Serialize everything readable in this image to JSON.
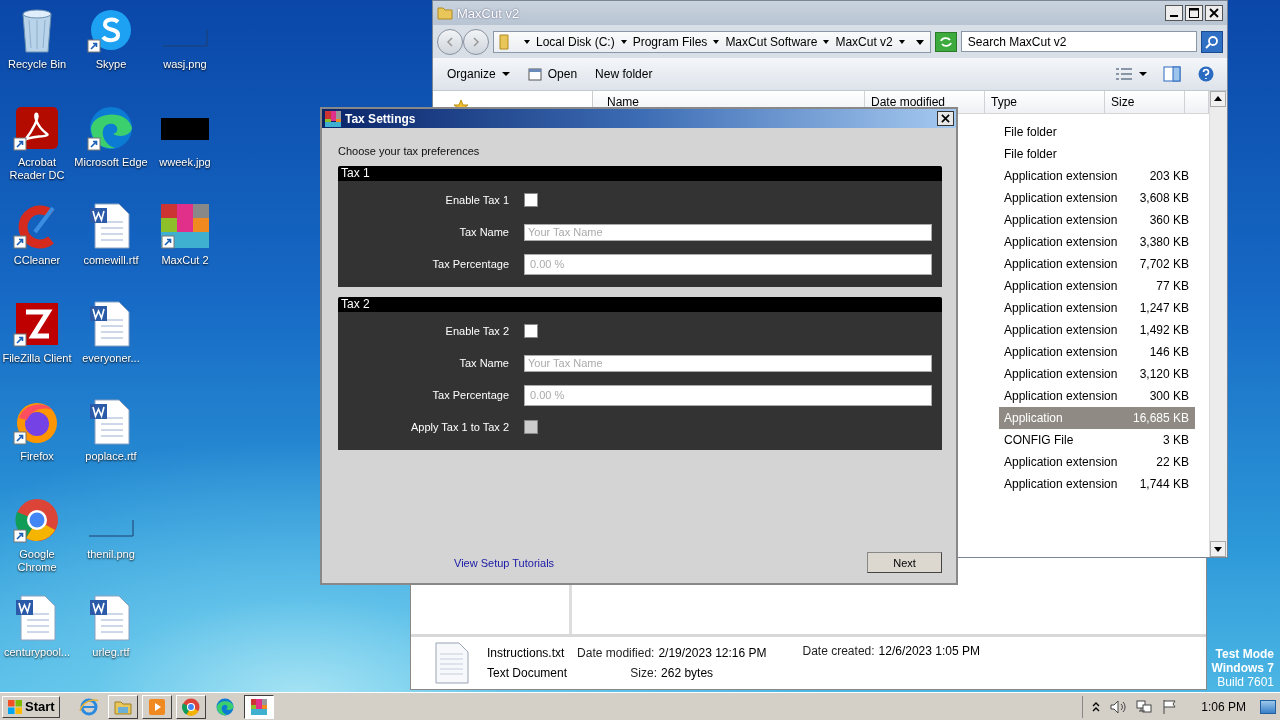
{
  "desktop_icons": [
    {
      "label": "Recycle Bin",
      "kind": "recycle",
      "shortcut": false
    },
    {
      "label": "Acrobat Reader DC",
      "kind": "pdf",
      "shortcut": true
    },
    {
      "label": "CCleaner",
      "kind": "ccleaner",
      "shortcut": true
    },
    {
      "label": "FileZilla Client",
      "kind": "filezilla",
      "shortcut": true
    },
    {
      "label": "Firefox",
      "kind": "firefox",
      "shortcut": true
    },
    {
      "label": "Google Chrome",
      "kind": "chrome",
      "shortcut": true
    },
    {
      "label": "centurypool...",
      "kind": "document",
      "shortcut": false
    },
    {
      "label": "Skype",
      "kind": "skype",
      "shortcut": true
    },
    {
      "label": "Microsoft Edge",
      "kind": "edge",
      "shortcut": true
    },
    {
      "label": "comewill.rtf",
      "kind": "document",
      "shortcut": false
    },
    {
      "label": "everyoner...",
      "kind": "document",
      "shortcut": false
    },
    {
      "label": "poplace.rtf",
      "kind": "document",
      "shortcut": false
    },
    {
      "label": "thenil.png",
      "kind": "blank",
      "shortcut": false
    },
    {
      "label": "urleg.rtf",
      "kind": "document",
      "shortcut": false
    },
    {
      "label": "wasj.png",
      "kind": "blank",
      "shortcut": false
    },
    {
      "label": "wweek.jpg",
      "kind": "dark",
      "shortcut": false
    },
    {
      "label": "MaxCut 2",
      "kind": "maxcut",
      "shortcut": true
    }
  ],
  "details_window": {
    "file_name": "Instructions.txt",
    "file_type": "Text Document",
    "date_modified_label": "Date modified:",
    "date_modified": "2/19/2023 12:16 PM",
    "date_created_label": "Date created:",
    "date_created": "12/6/2023 1:05 PM",
    "size_label": "Size:",
    "size": "262 bytes"
  },
  "explorer": {
    "title": "MaxCut v2",
    "breadcrumb": [
      "Local Disk (C:)",
      "Program Files",
      "MaxCut Software",
      "MaxCut v2"
    ],
    "search": {
      "placeholder": "Search MaxCut v2"
    },
    "toolbar": [
      "Organize",
      "Open",
      "New folder"
    ],
    "columns": [
      "Name",
      "Date modified",
      "Type",
      "Size"
    ],
    "rows": [
      {
        "type": "File folder",
        "selected": false
      },
      {
        "type": "File folder",
        "selected": false
      },
      {
        "type": "Application extension",
        "size": "203 KB",
        "selected": false
      },
      {
        "type": "Application extension",
        "size": "3,608 KB",
        "selected": false
      },
      {
        "type": "Application extension",
        "size": "360 KB",
        "selected": false
      },
      {
        "type": "Application extension",
        "size": "3,380 KB",
        "selected": false
      },
      {
        "type": "Application extension",
        "size": "7,702 KB",
        "selected": false
      },
      {
        "type": "Application extension",
        "size": "77 KB",
        "selected": false
      },
      {
        "type": "Application extension",
        "size": "1,247 KB",
        "selected": false
      },
      {
        "type": "Application extension",
        "size": "1,492 KB",
        "selected": false
      },
      {
        "type": "Application extension",
        "size": "146 KB",
        "selected": false
      },
      {
        "type": "Application extension",
        "size": "3,120 KB",
        "selected": false
      },
      {
        "type": "Application extension",
        "size": "300 KB",
        "selected": false
      },
      {
        "type": "Application",
        "size": "16,685 KB",
        "selected": true
      },
      {
        "type": "CONFIG File",
        "size": "3 KB",
        "selected": false
      },
      {
        "type": "Application extension",
        "size": "22 KB",
        "selected": false
      },
      {
        "type": "Application extension",
        "size": "1,744 KB",
        "selected": false
      }
    ]
  },
  "dialog": {
    "title": "Tax Settings",
    "intro": "Choose your tax preferences",
    "groups": [
      {
        "title": "Tax 1",
        "rows": [
          {
            "kind": "checkbox",
            "label": "Enable Tax 1",
            "checked": false,
            "disabled": false
          },
          {
            "kind": "text",
            "label": "Tax Name",
            "placeholder": "Your Tax Name"
          },
          {
            "kind": "text",
            "label": "Tax Percentage",
            "placeholder": "0.00 %"
          }
        ]
      },
      {
        "title": "Tax 2",
        "rows": [
          {
            "kind": "checkbox",
            "label": "Enable Tax 2",
            "checked": false,
            "disabled": false
          },
          {
            "kind": "text",
            "label": "Tax Name",
            "placeholder": "Your Tax Name"
          },
          {
            "kind": "text",
            "label": "Tax Percentage",
            "placeholder": "0.00 %"
          },
          {
            "kind": "checkbox",
            "label": "Apply Tax 1 to Tax 2",
            "checked": false,
            "disabled": true
          }
        ]
      }
    ],
    "link": "View Setup Tutorials",
    "next_button": "Next"
  },
  "os_notice": [
    "Test Mode",
    "Windows 7",
    "Build 7601"
  ],
  "taskbar": {
    "start": "Start",
    "apps": [
      {
        "kind": "ie",
        "selected": false
      },
      {
        "kind": "explorer",
        "selected": false
      },
      {
        "kind": "media",
        "selected": false
      },
      {
        "kind": "chrome",
        "selected": false
      },
      {
        "kind": "edge",
        "selected": false
      },
      {
        "kind": "maxcut",
        "selected": true
      }
    ],
    "time": "1:06 PM"
  }
}
